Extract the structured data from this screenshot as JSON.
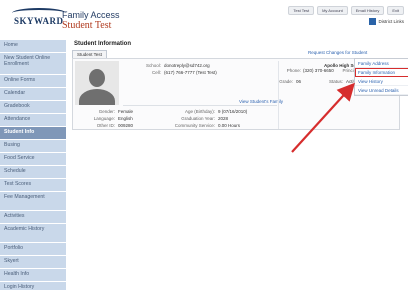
{
  "header": {
    "logo_text": "SKYWARD",
    "app_title": "Family Access",
    "student_name": "Student Test",
    "top_links": [
      "Test Test",
      "My Account",
      "Email History",
      "Exit"
    ],
    "district_links": "District Links"
  },
  "sidebar": {
    "items": [
      {
        "label": "Home",
        "active": false
      },
      {
        "label": "New Student Online Enrollment",
        "active": false
      },
      {
        "label": "Online Forms",
        "active": false
      },
      {
        "label": "Calendar",
        "active": false
      },
      {
        "label": "Gradebook",
        "active": false
      },
      {
        "label": "Attendance",
        "active": false
      },
      {
        "label": "Student Info",
        "active": true
      },
      {
        "label": "Busing",
        "active": false
      },
      {
        "label": "Food Service",
        "active": false
      },
      {
        "label": "Schedule",
        "active": false
      },
      {
        "label": "Test Scores",
        "active": false
      },
      {
        "label": "Fee Management",
        "active": false
      },
      {
        "label": "Activities",
        "active": false
      },
      {
        "label": "Academic History",
        "active": false
      },
      {
        "label": "Portfolio",
        "active": false
      },
      {
        "label": "Skyert",
        "active": false
      },
      {
        "label": "Health Info",
        "active": false
      },
      {
        "label": "Login History",
        "active": false
      }
    ]
  },
  "main": {
    "title": "Student Information",
    "tab": "Student Test",
    "school_label": "School:",
    "school_value": "donotreply@sd742.org",
    "cell_label": "Cell:",
    "cell_value": "(617) 766-7777 (Test Test)",
    "view_family_link": "View Student's Family",
    "gender_label": "Gender:",
    "gender_value": "Female",
    "language_label": "Language:",
    "language_value": "English",
    "other_id_label": "Other ID:",
    "other_id_value": "009280",
    "age_label": "Age (Birthday):",
    "age_value": "9 (07/16/2010)",
    "grad_label": "Graduation Year:",
    "grad_value": "2028",
    "service_label": "Community Service:",
    "service_value": "0.00 Hours",
    "school_name": "Apollo High School",
    "phone_label": "Phone:",
    "phone_value": "(320) 370-6650",
    "principal_label": "Principal:",
    "grade_label": "Grade:",
    "grade_value": "06",
    "status_label": "Status:",
    "status_value": "Active",
    "request_link": "Request Changes for Student",
    "dropdown": [
      "Family Address",
      "Family Information",
      "View History",
      "View Unread Details"
    ]
  },
  "colors": {
    "sidebar": "#c9d8ea",
    "sidebar_active": "#7f97b8",
    "link": "#2d63b0",
    "highlight": "#d62d2d"
  }
}
